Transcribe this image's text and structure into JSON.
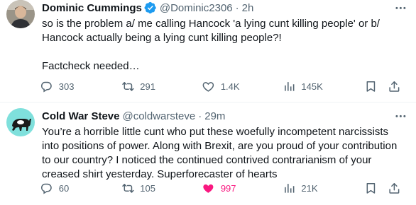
{
  "tweets": [
    {
      "author_name": "Dominic Cummings",
      "handle": "@Dominic2306",
      "separator": "·",
      "time": "2h",
      "verified": true,
      "text": "so is the problem a/ me calling Hancock 'a lying cunt killing people' or b/ Hancock actually being a lying cunt killing people?!\n\nFactcheck needed…",
      "replies": "303",
      "retweets": "291",
      "likes": "1.4K",
      "views": "145K",
      "liked": false
    },
    {
      "author_name": "Cold War Steve",
      "handle": "@coldwarsteve",
      "separator": "·",
      "time": "29m",
      "verified": false,
      "text": "You’re a horrible little cunt who put these woefully incompetent narcissists into positions of power. Along with Brexit, are you proud of your contribution to our country? I noticed the continued contrived contrarianism of your creased shirt yesterday. Superforecaster of hearts",
      "replies": "60",
      "retweets": "105",
      "likes": "997",
      "views": "21K",
      "liked": true
    }
  ],
  "colors": {
    "text": "#0f1419",
    "secondary": "#536471",
    "verified": "#1d9bf0",
    "like_active": "#f91880",
    "divider": "#eff3f4"
  },
  "icons": [
    "more-icon",
    "reply-icon",
    "retweet-icon",
    "like-icon",
    "views-icon",
    "bookmark-icon",
    "share-icon",
    "verified-badge-icon"
  ]
}
